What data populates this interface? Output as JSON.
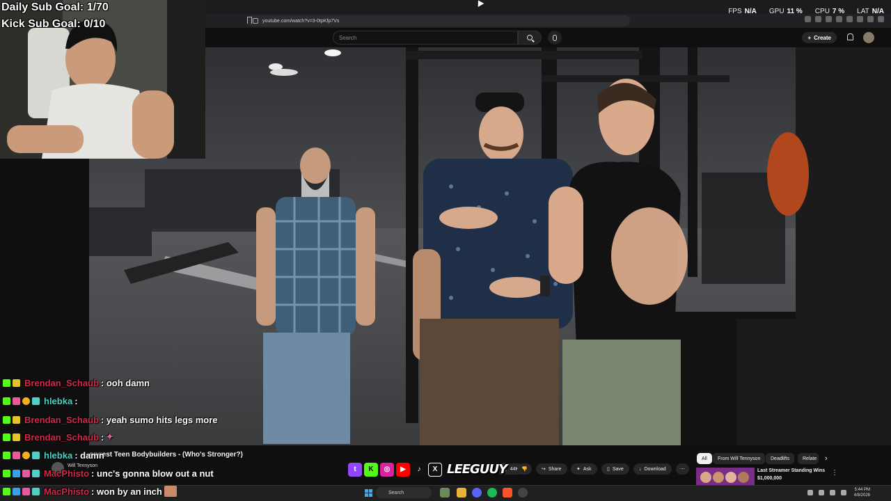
{
  "stream_overlay": {
    "daily_sub_goal": "Daily Sub Goal: 1/70",
    "kick_sub_goal": "Kick Sub Goal: 0/10"
  },
  "perf_stats": [
    {
      "label": "FPS",
      "value": "N/A"
    },
    {
      "label": "GPU",
      "value": "11 %"
    },
    {
      "label": "CPU",
      "value": "7 %"
    },
    {
      "label": "LAT",
      "value": "N/A"
    }
  ],
  "browser": {
    "url": "youtube.com/watch?v=3-0tpKfp7Vs"
  },
  "youtube": {
    "search_placeholder": "Search",
    "create_label": "Create",
    "video_title": "...ongest Teen Bodybuilders - (Who's Stronger?)",
    "channel_name": "Will Tennyson",
    "like_count": "44K",
    "actions": {
      "share": "Share",
      "ask": "Ask",
      "save": "Save",
      "download": "Download"
    },
    "chips": [
      "All",
      "From Will Tennyson",
      "Deadlifts",
      "Relate"
    ],
    "recommended": {
      "title": "Last Streamer Standing Wins",
      "subtitle": "$1,000,000"
    }
  },
  "chat": [
    {
      "user": "Brendan_Schaub",
      "user_color": "#d02a4a",
      "message": ": ooh damn"
    },
    {
      "user": "hlebka",
      "user_color": "#4fd1c5",
      "message": ":"
    },
    {
      "user": "Brendan_Schaub",
      "user_color": "#d02a4a",
      "message": ": yeah sumo hits legs more"
    },
    {
      "user": "Brendan_Schaub",
      "user_color": "#d02a4a",
      "message": ":"
    },
    {
      "user": "hlebka",
      "user_color": "#4fd1c5",
      "message": ": damn"
    },
    {
      "user": "MacPhisto",
      "user_color": "#d02a4a",
      "message": ": unc's gonna blow out a nut"
    },
    {
      "user": "MacPhisto",
      "user_color": "#d02a4a",
      "message": ": won by an inch"
    }
  ],
  "taskbar": {
    "search_label": "Search",
    "time": "5:44 PM",
    "date": "4/8/2026"
  },
  "colors": {
    "accent": "#ff0000",
    "kick_green": "#53fc18",
    "twitch_purple": "#9146ff"
  }
}
